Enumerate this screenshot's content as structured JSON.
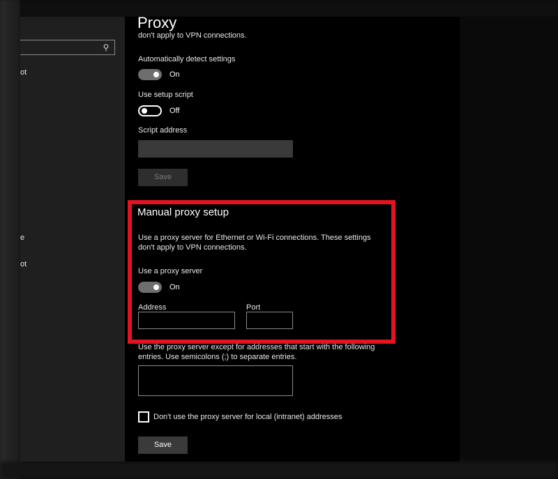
{
  "page_title": "Proxy",
  "top_partial_text": "don't apply to VPN connections.",
  "sidebar": {
    "search_icon": "search-icon",
    "fragments": [
      "ot",
      "e",
      "ot"
    ]
  },
  "auto_detect": {
    "label": "Automatically detect settings",
    "state": "On"
  },
  "setup_script": {
    "label": "Use setup script",
    "state": "Off"
  },
  "script_address": {
    "label": "Script address",
    "value": "",
    "save_label": "Save"
  },
  "manual_proxy": {
    "title": "Manual proxy setup",
    "description_line1": "Use a proxy server for Ethernet or Wi-Fi connections. These settings",
    "description_line2": "don't apply to VPN connections.",
    "use_proxy_label": "Use a proxy server",
    "use_proxy_state": "On",
    "address_label": "Address",
    "address_value": "",
    "port_label": "Port",
    "port_value": ""
  },
  "exceptions": {
    "line1": "Use the proxy server except for addresses that start with the following",
    "line2": "entries. Use semicolons (;) to separate entries.",
    "value": ""
  },
  "local_bypass": {
    "label": "Don't use the proxy server for local (intranet) addresses",
    "checked": false
  },
  "save_label": "Save",
  "highlight_color": "#e3141f"
}
